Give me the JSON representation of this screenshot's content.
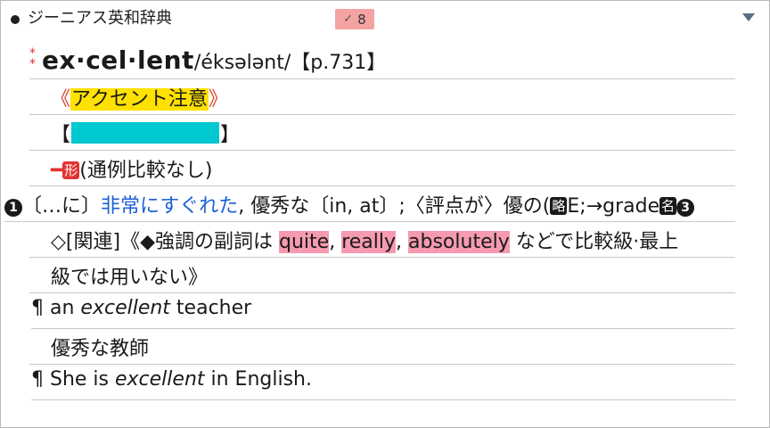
{
  "header": {
    "dictionary_name": "ジーニアス英和辞典",
    "badge_check": "✓",
    "badge_count": "8"
  },
  "entry": {
    "star1": "*",
    "star2": "*",
    "headword": "ex·cel·lent",
    "pronunciation": "/éksələnt/",
    "page_ref": "【p.731】",
    "accent_open": "《",
    "accent_text": "アクセント注意",
    "accent_close": "》",
    "bracket_open": "【",
    "bracket_close": "】",
    "pos_dash": "━",
    "pos_label": "形",
    "pos_note": "(通例比較なし)",
    "sense_num": "1",
    "sense_pre": "〔…に〕",
    "sense_blue": "非常にすぐれた",
    "sense_post": ", 優秀な〔in, at〕;〈評点が〉優の(",
    "abbr_label": "略",
    "sense_tail": "E;→grade",
    "noun_label": "名",
    "circ3": "3",
    "usage_pre": "◇[関連]《◆強調の副詞は ",
    "usage_quite": "quite",
    "usage_sep1": ", ",
    "usage_really": "really",
    "usage_sep2": ", ",
    "usage_absolutely": "absolutely",
    "usage_post": " などで比較級·最上",
    "usage_cont": "級では用いない》",
    "ex1_mark": "¶",
    "ex1_pre": " an ",
    "ex1_it": "excellent",
    "ex1_post": " teacher",
    "ex1_trans": "優秀な教師",
    "ex2_mark": "¶",
    "ex2_pre": " She is ",
    "ex2_it": "excellent",
    "ex2_post": " in English."
  }
}
